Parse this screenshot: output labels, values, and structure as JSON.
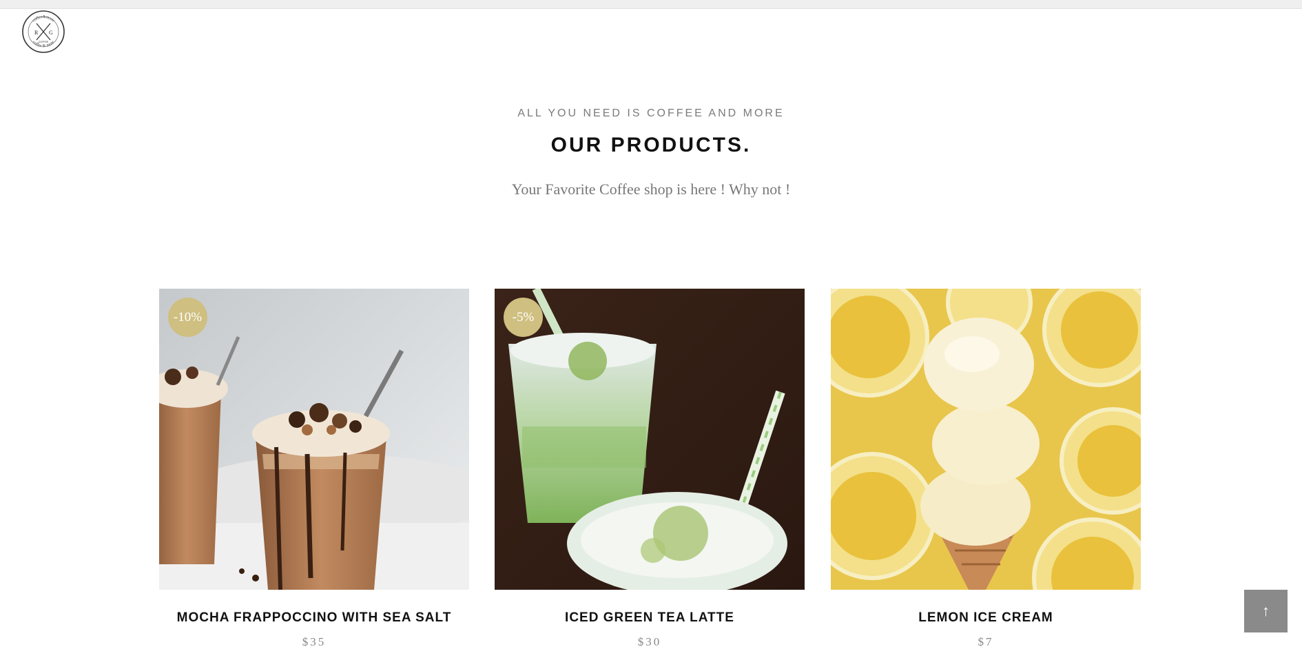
{
  "brand": {
    "logo_alt": "coffee & more logo",
    "logo_ring_top": "coffee&more",
    "logo_ring_bottom": "coffee & more",
    "logo_left": "R",
    "logo_right": "G",
    "logo_center": "COFFEE"
  },
  "hero": {
    "tagline": "ALL YOU NEED IS COFFEE AND MORE",
    "heading": "OUR PRODUCTS.",
    "subtitle": "Your Favorite Coffee shop is here ! Why not !"
  },
  "products": [
    {
      "name": "MOCHA FRAPPOCCINO WITH SEA SALT",
      "price": "$35",
      "badge": "-10%",
      "image": "mocha-frappuccino-photo"
    },
    {
      "name": "ICED GREEN TEA LATTE",
      "price": "$30",
      "badge": "-5%",
      "image": "green-tea-latte-photo"
    },
    {
      "name": "LEMON ICE CREAM",
      "price": "$7",
      "badge": "",
      "image": "lemon-ice-cream-photo"
    }
  ],
  "controls": {
    "back_to_top_icon": "arrow-up-icon",
    "back_to_top_glyph": "↑"
  },
  "colors": {
    "badge": "#cfbf80",
    "back_to_top": "#8a8a8a",
    "tagline": "#7a7a7a"
  }
}
